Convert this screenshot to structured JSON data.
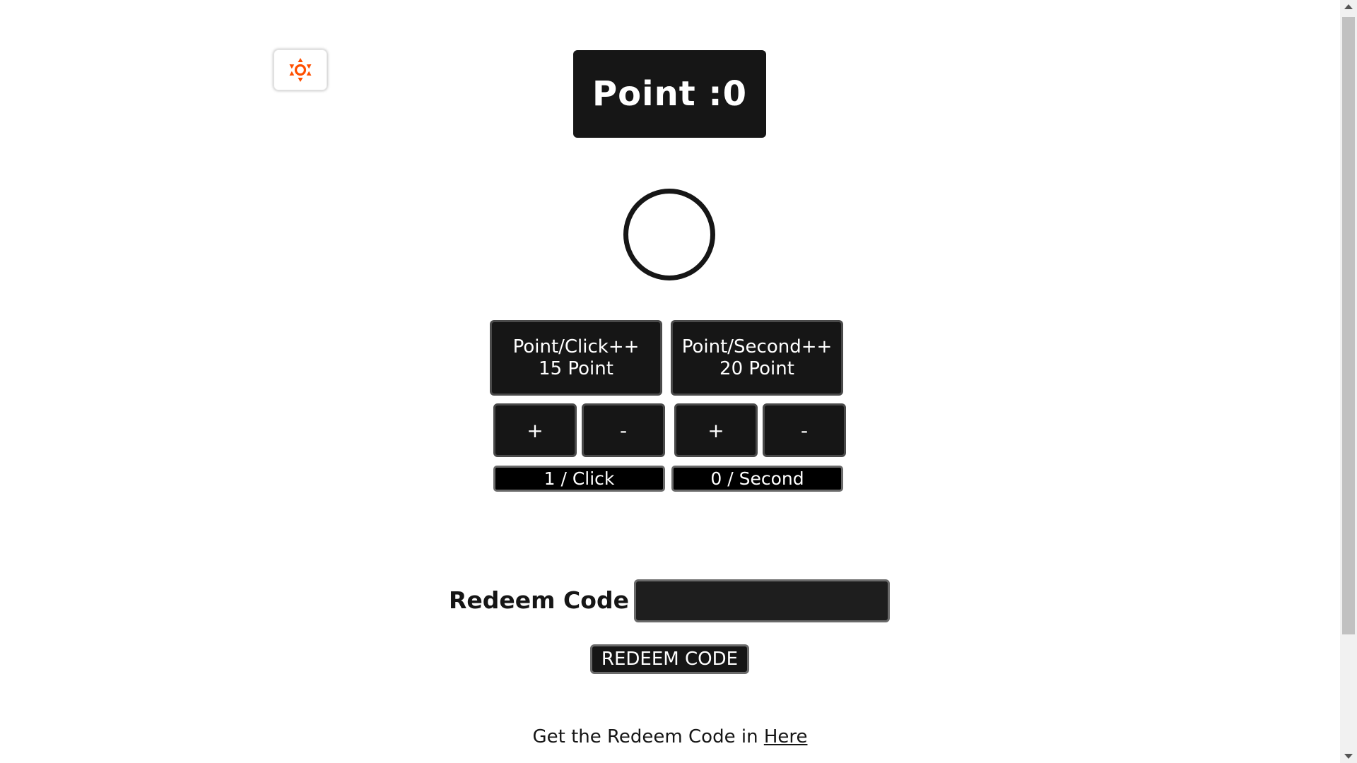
{
  "theme_toggle": {
    "icon": "sun-icon",
    "color": "#ff4f00"
  },
  "score": {
    "label": "Point :",
    "value": "0"
  },
  "upgrades": {
    "click": {
      "title": "Point/Click++",
      "cost": "15 Point",
      "rate": "1 / Click"
    },
    "second": {
      "title": "Point/Second++",
      "cost": "20 Point",
      "rate": "0 / Second"
    }
  },
  "steppers": {
    "plus": "+",
    "minus": "-"
  },
  "redeem": {
    "label": "Redeem Code :",
    "value": "",
    "button": "REDEEM CODE"
  },
  "footer": {
    "text": "Get the Redeem Code in ",
    "link": "Here"
  }
}
